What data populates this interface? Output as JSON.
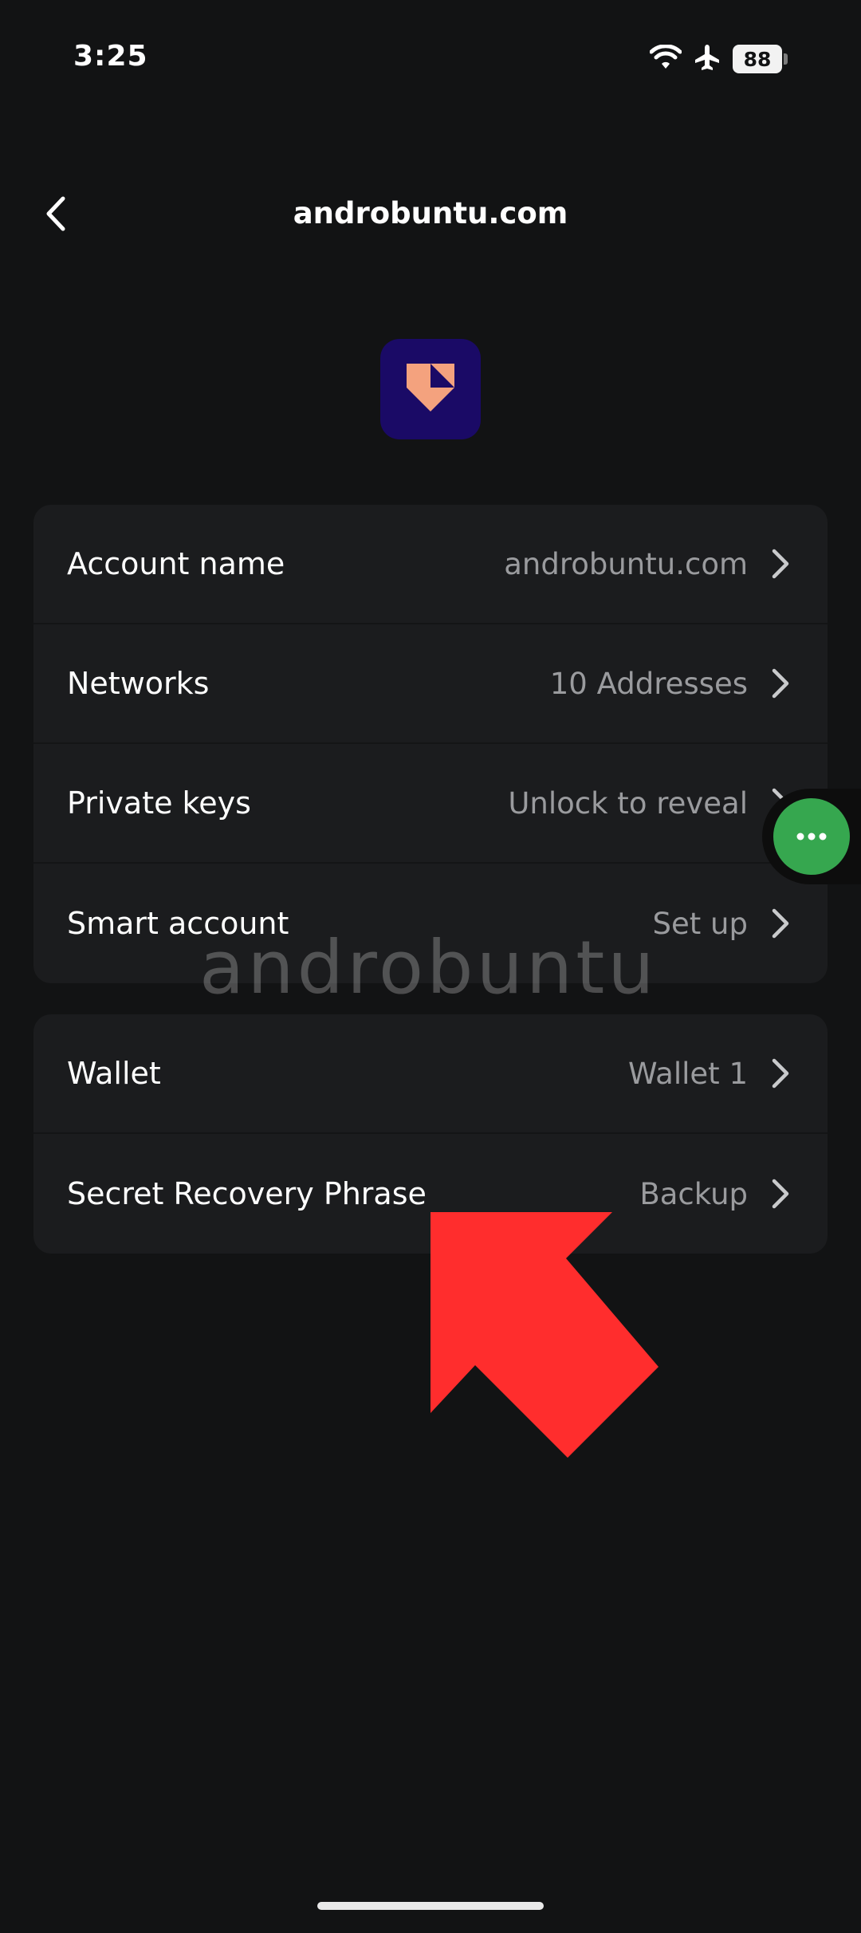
{
  "status_bar": {
    "time": "3:25",
    "battery": "88",
    "icons": [
      "wifi-icon",
      "airplane-icon",
      "battery-icon"
    ]
  },
  "header": {
    "title": "androbuntu.com",
    "back_icon": "chevron-left-icon"
  },
  "avatar": {
    "icon": "account-logo-icon",
    "background": "#1a0a66",
    "accent": "#f4a27e"
  },
  "sections": [
    {
      "rows": [
        {
          "label": "Account name",
          "value": "androbuntu.com"
        },
        {
          "label": "Networks",
          "value": "10 Addresses"
        },
        {
          "label": "Private keys",
          "value": "Unlock to reveal"
        },
        {
          "label": "Smart account",
          "value": "Set up"
        }
      ]
    },
    {
      "rows": [
        {
          "label": "Wallet",
          "value": "Wallet 1"
        },
        {
          "label": "Secret Recovery Phrase",
          "value": "Backup"
        }
      ]
    }
  ],
  "watermark": "androbuntu",
  "floating_button": {
    "icon": "more-dots-icon",
    "color": "#36a74f"
  },
  "annotation_arrow": {
    "color": "#ff2d2d"
  },
  "colors": {
    "background": "#121314",
    "card": "#1b1c1e",
    "value_text": "#9a9b9e"
  }
}
